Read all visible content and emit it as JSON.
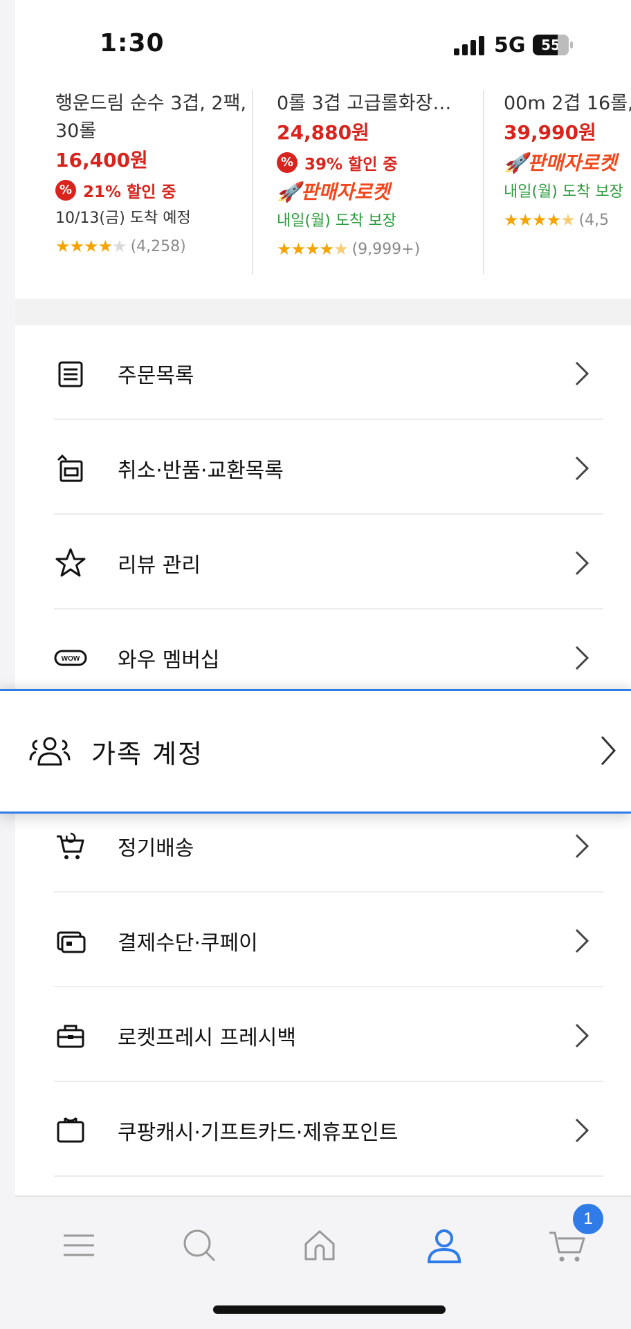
{
  "status_bar": {
    "time": "1:30",
    "network": "5G",
    "battery": "55"
  },
  "products": [
    {
      "name": "행운드림 순수 3겹, 2팩, 30롤",
      "price": "16,400원",
      "discount": "21% 할인 중",
      "arrival": "10/13(금) 도착 예정",
      "rating_count": "(4,258)",
      "stars": 4
    },
    {
      "name": "0롤 3겹 고급롤화장…",
      "price": "24,880원",
      "discount": "39% 할인 중",
      "badge": "판매자로켓",
      "arrival": "내일(월) 도착 보장",
      "rating_count": "(9,999+)",
      "stars": 4.5
    },
    {
      "name": "00m 2겹 16롤,",
      "price": "39,990원",
      "badge": "판매자로켓",
      "arrival": "내일(월) 도착 보장",
      "rating_count": "(4,5",
      "stars": 4.5
    }
  ],
  "menu": {
    "orders": "주문목록",
    "returns": "취소·반품·교환목록",
    "reviews": "리뷰 관리",
    "wow": "와우 멤버십",
    "family": "가족 계정",
    "subscription": "정기배송",
    "payment": "결제수단·쿠페이",
    "fresh": "로켓프레시 프레시백",
    "cash": "쿠팡캐시·기프트카드·제휴포인트"
  },
  "tabbar": {
    "items": [
      "menu-icon",
      "search-icon",
      "home-icon",
      "profile-icon",
      "cart-icon"
    ],
    "active": "profile-icon",
    "cart_count": "1"
  },
  "colors": {
    "accent": "#2f7be8",
    "price": "#d8241c",
    "rocket": "#f2471b",
    "green": "#2c9c3c",
    "star": "#f5a300"
  }
}
